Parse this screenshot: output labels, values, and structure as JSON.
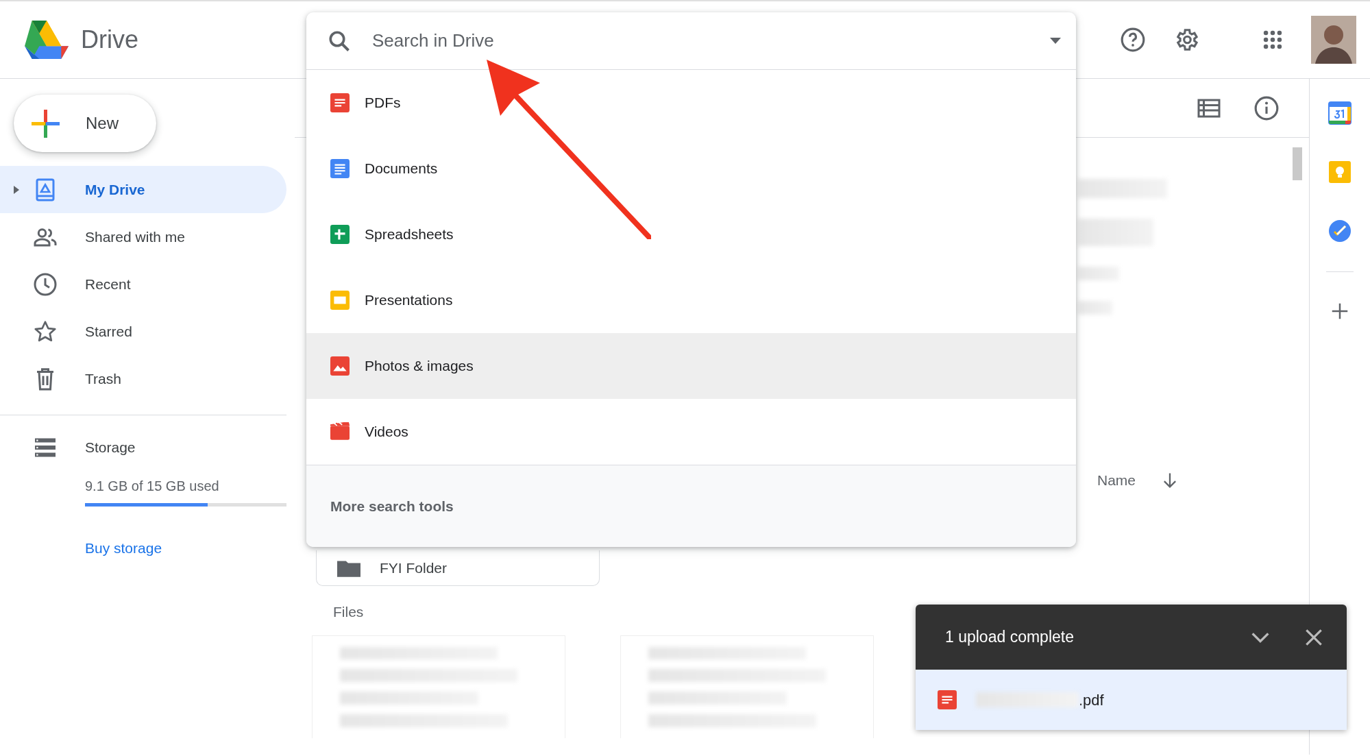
{
  "app": {
    "name": "Drive"
  },
  "search": {
    "placeholder": "Search in Drive"
  },
  "new_button": {
    "label": "New"
  },
  "sidebar": {
    "items": [
      {
        "label": "My Drive",
        "selected": true,
        "expanded": false
      },
      {
        "label": "Shared with me",
        "selected": false
      },
      {
        "label": "Recent",
        "selected": false
      },
      {
        "label": "Starred",
        "selected": false
      },
      {
        "label": "Trash",
        "selected": false
      }
    ]
  },
  "storage": {
    "label": "Storage",
    "usage": "9.1 GB of 15 GB used",
    "level": 0.61,
    "link": "Buy storage"
  },
  "search_menu": {
    "items": [
      {
        "label": "PDFs",
        "selected": false
      },
      {
        "label": "Documents",
        "selected": false
      },
      {
        "label": "Spreadsheets",
        "selected": false
      },
      {
        "label": "Presentations",
        "selected": false
      },
      {
        "label": "Photos & images",
        "selected": true
      },
      {
        "label": "Videos",
        "selected": false
      }
    ],
    "footer": "More search tools"
  },
  "content": {
    "sort": {
      "label": "Name"
    },
    "folder": "FYI Folder",
    "files_heading": "Files"
  },
  "upload_panel": {
    "title": "1 upload complete",
    "file": ".pdf"
  }
}
